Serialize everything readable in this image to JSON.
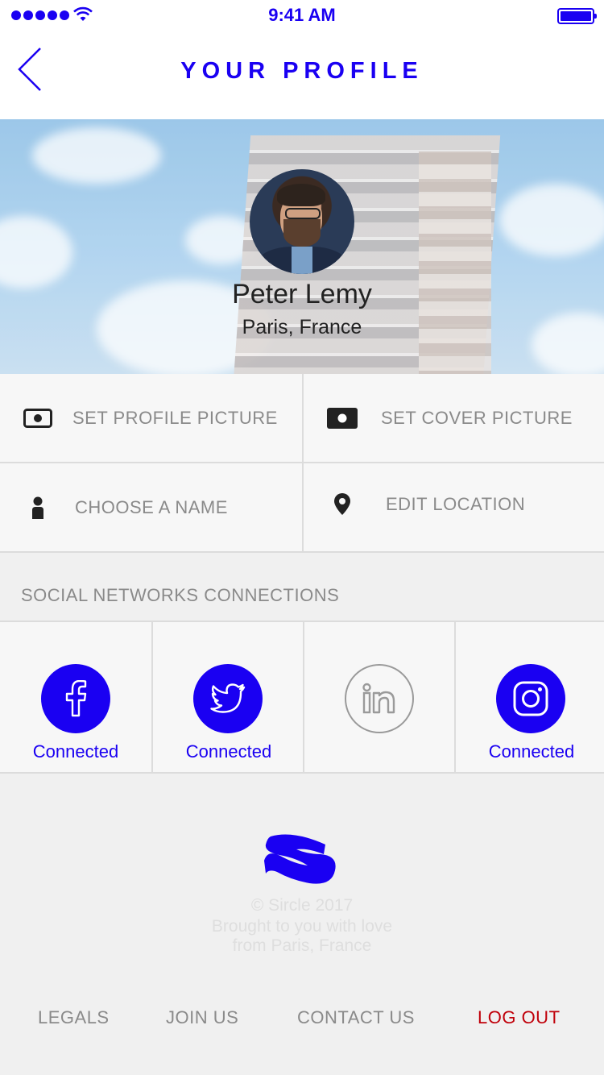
{
  "status_bar": {
    "time": "9:41 AM",
    "signal_icon": "signal-dots-icon",
    "wifi_icon": "wifi-icon",
    "battery_icon": "battery-icon"
  },
  "nav": {
    "title": "YOUR PROFILE",
    "back_icon": "chevron-left-icon"
  },
  "profile": {
    "name": "Peter Lemy",
    "location": "Paris, France"
  },
  "actions": [
    {
      "label": "SET PROFILE PICTURE",
      "icon": "camera-outline-icon"
    },
    {
      "label": "SET COVER PICTURE",
      "icon": "camera-filled-icon"
    },
    {
      "label": "CHOOSE A NAME",
      "icon": "person-icon"
    },
    {
      "label": "EDIT LOCATION",
      "icon": "location-pin-icon"
    }
  ],
  "social": {
    "title": "SOCIAL NETWORKS CONNECTIONS",
    "items": [
      {
        "network": "facebook",
        "icon": "facebook-icon",
        "status": "Connected",
        "connected": true
      },
      {
        "network": "twitter",
        "icon": "twitter-icon",
        "status": "Connected",
        "connected": true
      },
      {
        "network": "linkedin",
        "icon": "linkedin-icon",
        "status": "",
        "connected": false
      },
      {
        "network": "instagram",
        "icon": "instagram-icon",
        "status": "Connected",
        "connected": true
      }
    ]
  },
  "footer": {
    "logo_icon": "sircle-logo-icon",
    "copyright": "© Sircle 2017",
    "line2": "Brought to you with love",
    "line3": "from Paris, France",
    "links": [
      "LEGALS",
      "JOIN US",
      "CONTACT US",
      "LOG OUT"
    ]
  },
  "colors": {
    "accent": "#1a00f2",
    "logout": "#c0000a",
    "muted": "#8a8a8a"
  }
}
